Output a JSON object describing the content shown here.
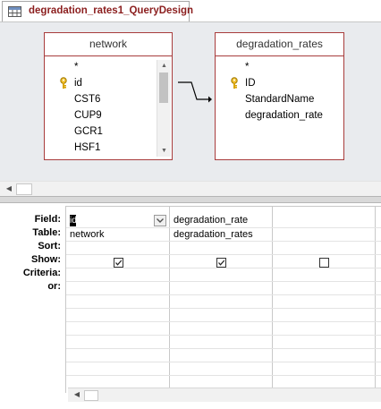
{
  "tab": {
    "title": "degradation_rates1_QueryDesign"
  },
  "tables": {
    "network": {
      "title": "network",
      "fields": [
        "*",
        "id",
        "CST6",
        "CUP9",
        "GCR1",
        "HSF1"
      ]
    },
    "degradation_rates": {
      "title": "degradation_rates",
      "fields": [
        "*",
        "ID",
        "StandardName",
        "degradation_rate"
      ]
    }
  },
  "grid": {
    "row_labels": {
      "field": "Field:",
      "table": "Table:",
      "sort": "Sort:",
      "show": "Show:",
      "criteria": "Criteria:",
      "or": "or:"
    },
    "columns": [
      {
        "field": "id",
        "table": "network",
        "show": true
      },
      {
        "field": "degradation_rate",
        "table": "degradation_rates",
        "show": true
      },
      {
        "field": "",
        "table": "",
        "show": false
      }
    ]
  },
  "colors": {
    "tab_title": "#8b1e1e",
    "table_border": "#a83c3c",
    "upper_pane_bg": "#e9ebee"
  }
}
